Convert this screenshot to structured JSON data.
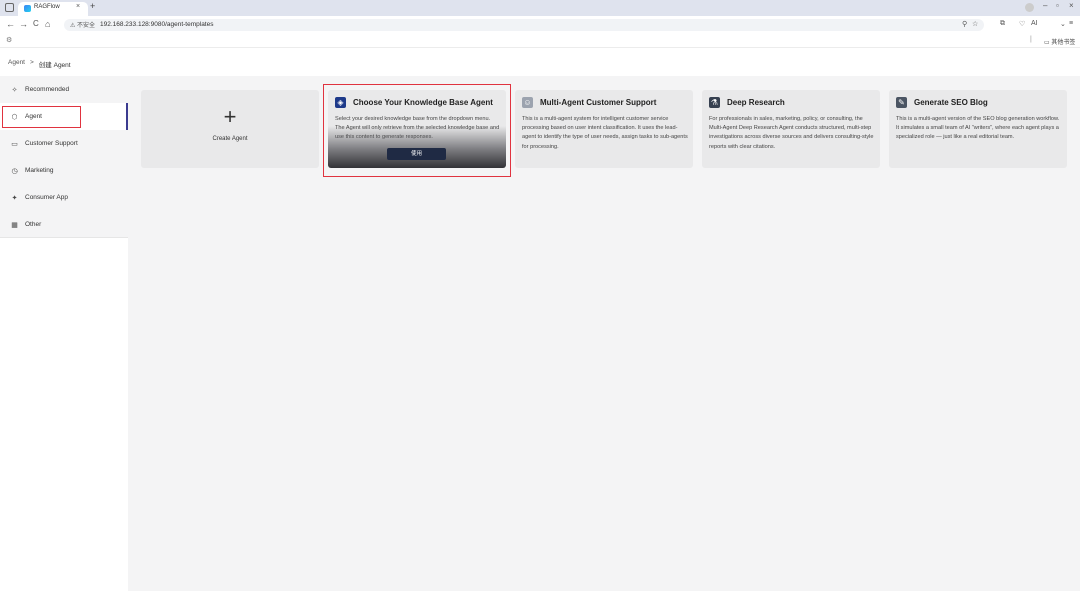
{
  "browser": {
    "tab_title": "RAGFlow",
    "tab_close": "×",
    "new_tab": "+",
    "window_controls": [
      "–",
      "▫",
      "×"
    ],
    "address": {
      "security_label": "⚠ 不安全",
      "url": "192.168.233.128:9080/agent-templates"
    },
    "nav": {
      "back": "←",
      "forward": "→",
      "reload": "C",
      "home": "⌂"
    },
    "toolbar_ai_label": "AI",
    "bookmarks_folder": "▭ 其他书签",
    "bookmarks_separator": "|"
  },
  "breadcrumb": {
    "root": "Agent",
    "separator": ">",
    "current": "创建 Agent"
  },
  "sidebar": {
    "items": [
      {
        "label": "Recommended",
        "icon": "sparkle-icon",
        "glyph": "✧"
      },
      {
        "label": "Agent",
        "icon": "agent-icon",
        "glyph": "⬡",
        "active": true
      },
      {
        "label": "Customer Support",
        "icon": "chat-icon",
        "glyph": "▭"
      },
      {
        "label": "Marketing",
        "icon": "clock-icon",
        "glyph": "◷"
      },
      {
        "label": "Consumer App",
        "icon": "sparkle-icon",
        "glyph": "✦"
      },
      {
        "label": "Other",
        "icon": "grid-icon",
        "glyph": "▦"
      }
    ]
  },
  "cards": {
    "create": {
      "plus": "+",
      "label": "Create Agent"
    },
    "templates": [
      {
        "title": "Choose Your Knowledge Base Agent",
        "description": "Select your desired knowledge base from the dropdown menu. The Agent will only retrieve from the selected knowledge base and use this content to generate responses.",
        "icon": "database-icon",
        "icon_color": "#1e3a8a",
        "button_label": "使用"
      },
      {
        "title": "Multi-Agent Customer Support",
        "description": "This is a multi-agent system for intelligent customer service processing based on user intent classification. It uses the lead-agent to identify the type of user needs, assign tasks to sub-agents for processing.",
        "icon": "robot-icon",
        "icon_color": "#9ca3af"
      },
      {
        "title": "Deep Research",
        "description": "For professionals in sales, marketing, policy, or consulting, the Multi-Agent Deep Research Agent conducts structured, multi-step investigations across diverse sources and delivers consulting-style reports with clear citations.",
        "icon": "research-icon",
        "icon_color": "#374151"
      },
      {
        "title": "Generate SEO Blog",
        "description": "This is a multi-agent version of the SEO blog generation workflow. It simulates a small team of AI “writers”, where each agent plays a specialized role — just like a real editorial team.",
        "icon": "blog-icon",
        "icon_color": "#4b5563"
      }
    ]
  }
}
